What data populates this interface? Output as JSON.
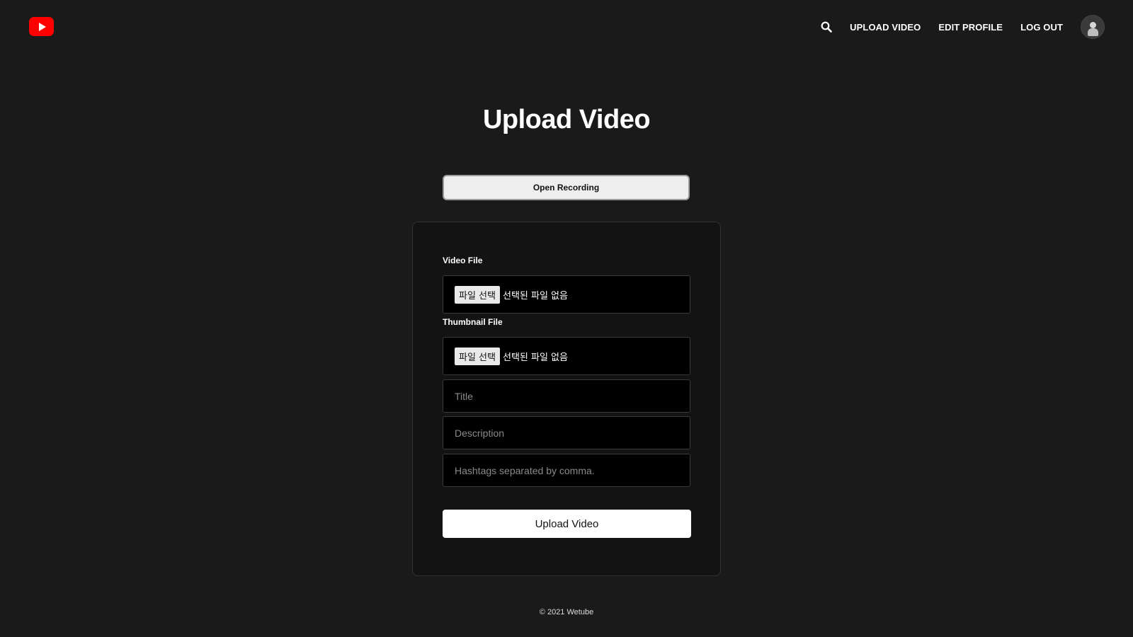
{
  "header": {
    "logo_icon": "youtube-play-icon",
    "search_icon": "search-icon",
    "nav": {
      "upload_video": "UPLOAD VIDEO",
      "edit_profile": "EDIT PROFILE",
      "log_out": "LOG OUT"
    },
    "avatar_icon": "user-avatar-icon"
  },
  "main": {
    "title": "Upload Video",
    "open_recording_label": "Open Recording",
    "form": {
      "video_file_label": "Video File",
      "video_file_button": "파일 선택",
      "video_file_status": "선택된 파일 없음",
      "thumbnail_file_label": "Thumbnail File",
      "thumbnail_file_button": "파일 선택",
      "thumbnail_file_status": "선택된 파일 없음",
      "title_placeholder": "Title",
      "title_value": "",
      "description_placeholder": "Description",
      "description_value": "",
      "hashtags_placeholder": "Hashtags separated by comma.",
      "hashtags_value": "",
      "submit_label": "Upload Video"
    }
  },
  "footer": {
    "copyright": "© 2021 Wetube"
  },
  "colors": {
    "background": "#1a1a1a",
    "brand": "#ff0000",
    "card": "#131313",
    "input": "#000000"
  }
}
